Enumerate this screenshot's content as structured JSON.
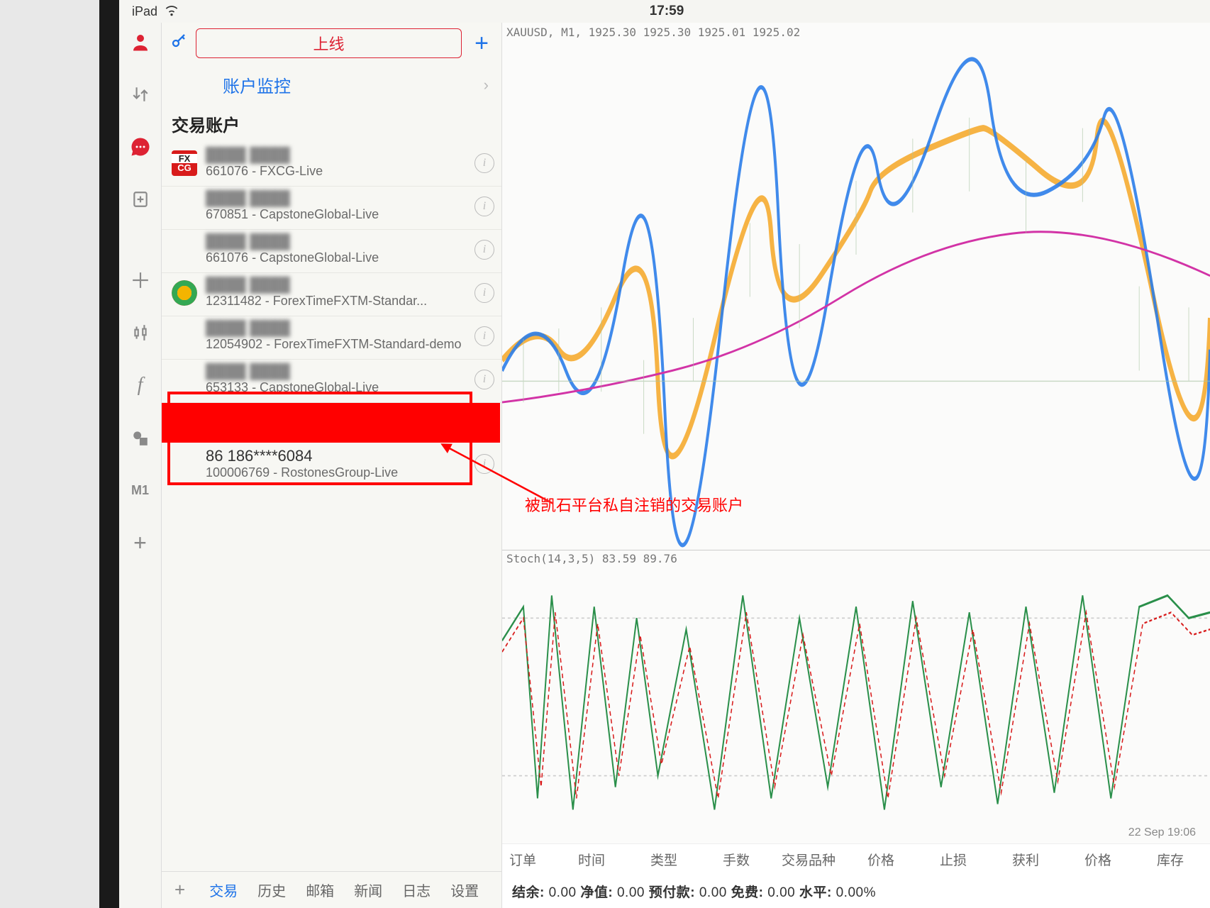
{
  "status": {
    "device": "iPad",
    "time": "17:59"
  },
  "panel": {
    "online_btn": "上线",
    "monitor": "账户监控",
    "section": "交易账户"
  },
  "accounts": [
    {
      "name": "████ ████",
      "sub": "661076 - FXCG-Live",
      "logo": "fxcg"
    },
    {
      "name": "████ ████",
      "sub": "670851 - CapstoneGlobal-Live",
      "logo": "blank"
    },
    {
      "name": "████ ████",
      "sub": "661076 - CapstoneGlobal-Live",
      "logo": "blank"
    },
    {
      "name": "████ ████",
      "sub": "12311482 - ForexTimeFXTM-Standar...",
      "logo": "ftm"
    },
    {
      "name": "████ ████",
      "sub": "12054902 - ForexTimeFXTM-Standard-demo",
      "logo": "blank"
    },
    {
      "name": "████ ████",
      "sub": "653133 - CapstoneGlobal-Live",
      "logo": "blank"
    },
    {
      "name": "86 186****6084",
      "sub": "100006769 - RostonesGroup-Live",
      "logo": "blank",
      "clear": true
    }
  ],
  "chart": {
    "main_label": "XAUUSD, M1, 1925.30 1925.30 1925.01 1925.02",
    "ind_label": "Stoch(14,3,5) 83.59 89.76",
    "date": "22 Sep 19:06"
  },
  "tabs": [
    "交易",
    "历史",
    "邮箱",
    "新闻",
    "日志",
    "设置"
  ],
  "columns": [
    "订单",
    "时间",
    "类型",
    "手数",
    "交易品种",
    "价格",
    "止损",
    "获利",
    "价格",
    "库存"
  ],
  "balance": {
    "l1": "结余:",
    "v1": "0.00",
    "l2": "净值:",
    "v2": "0.00",
    "l3": "预付款:",
    "v3": "0.00",
    "l4": "免费:",
    "v4": "0.00",
    "l5": "水平:",
    "v5": "0.00%"
  },
  "rail_timeframe": "M1",
  "annotation": "被凯石平台私自注销的交易账户"
}
